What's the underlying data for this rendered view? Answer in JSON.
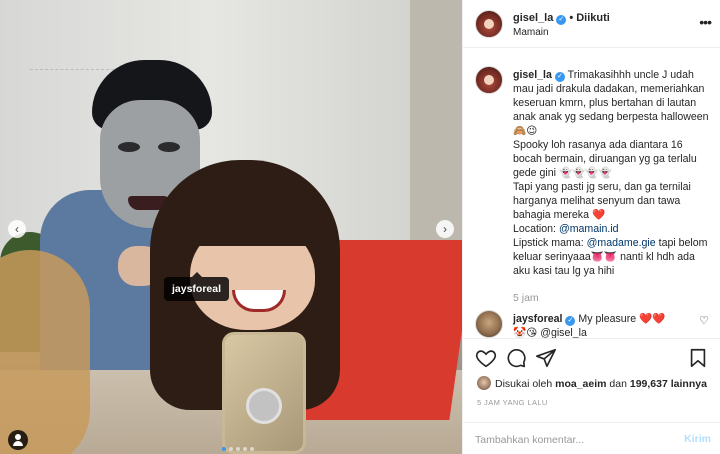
{
  "post": {
    "tag_label": "jaysforeal",
    "carousel_dots": 5,
    "carousel_active": 0
  },
  "header": {
    "username": "gisel_la",
    "verified_mark": "✓",
    "separator": "•",
    "follow_status": "Diikuti",
    "location": "Mamain",
    "more_icon": "more-horizontal-icon"
  },
  "caption": {
    "username": "gisel_la",
    "text_1": "Trimakasihhh uncle J udah mau jadi drakula dadakan, memeriahkan keseruan kmrn, plus bertahan di lautan anak anak yg sedang berpesta halloween",
    "emoji_1": "🙈😉",
    "text_2": "Spooky loh rasanya ada diantara 16 bocah bermain, diruangan yg ga terlalu gede gini",
    "emoji_2": "👻👻👻👻",
    "text_3": "Tapi yang pasti jg seru, dan ga ternilai harganya melihat senyum dan tawa bahagia mereka",
    "emoji_3": "❤️",
    "location_label": "Location:",
    "location_mention": "@mamain.id",
    "lipstick_label": "Lipstick mama:",
    "lipstick_mention": "@madame.gie",
    "text_4": "tapi belom keluar serinyaaa",
    "emoji_4": "👅👅",
    "text_5": "nanti kl hdh ada aku kasi tau lg ya hihi",
    "time": "5 jam"
  },
  "reply": {
    "username": "jaysforeal",
    "text": "My pleasure",
    "emoji": "❤️❤️",
    "emoji_2": "🤡😘",
    "mention": "@gisel_la"
  },
  "likes": {
    "prefix": "Disukai oleh",
    "user": "moa_aeim",
    "conj": "dan",
    "count": "199,637 lainnya"
  },
  "post_time": "5 JAM YANG LALU",
  "comment_box": {
    "placeholder": "Tambahkan komentar...",
    "submit_label": "Kirim"
  },
  "colors": {
    "accent": "#3897f0",
    "like_red": "#ed4956",
    "muted": "#999999"
  }
}
